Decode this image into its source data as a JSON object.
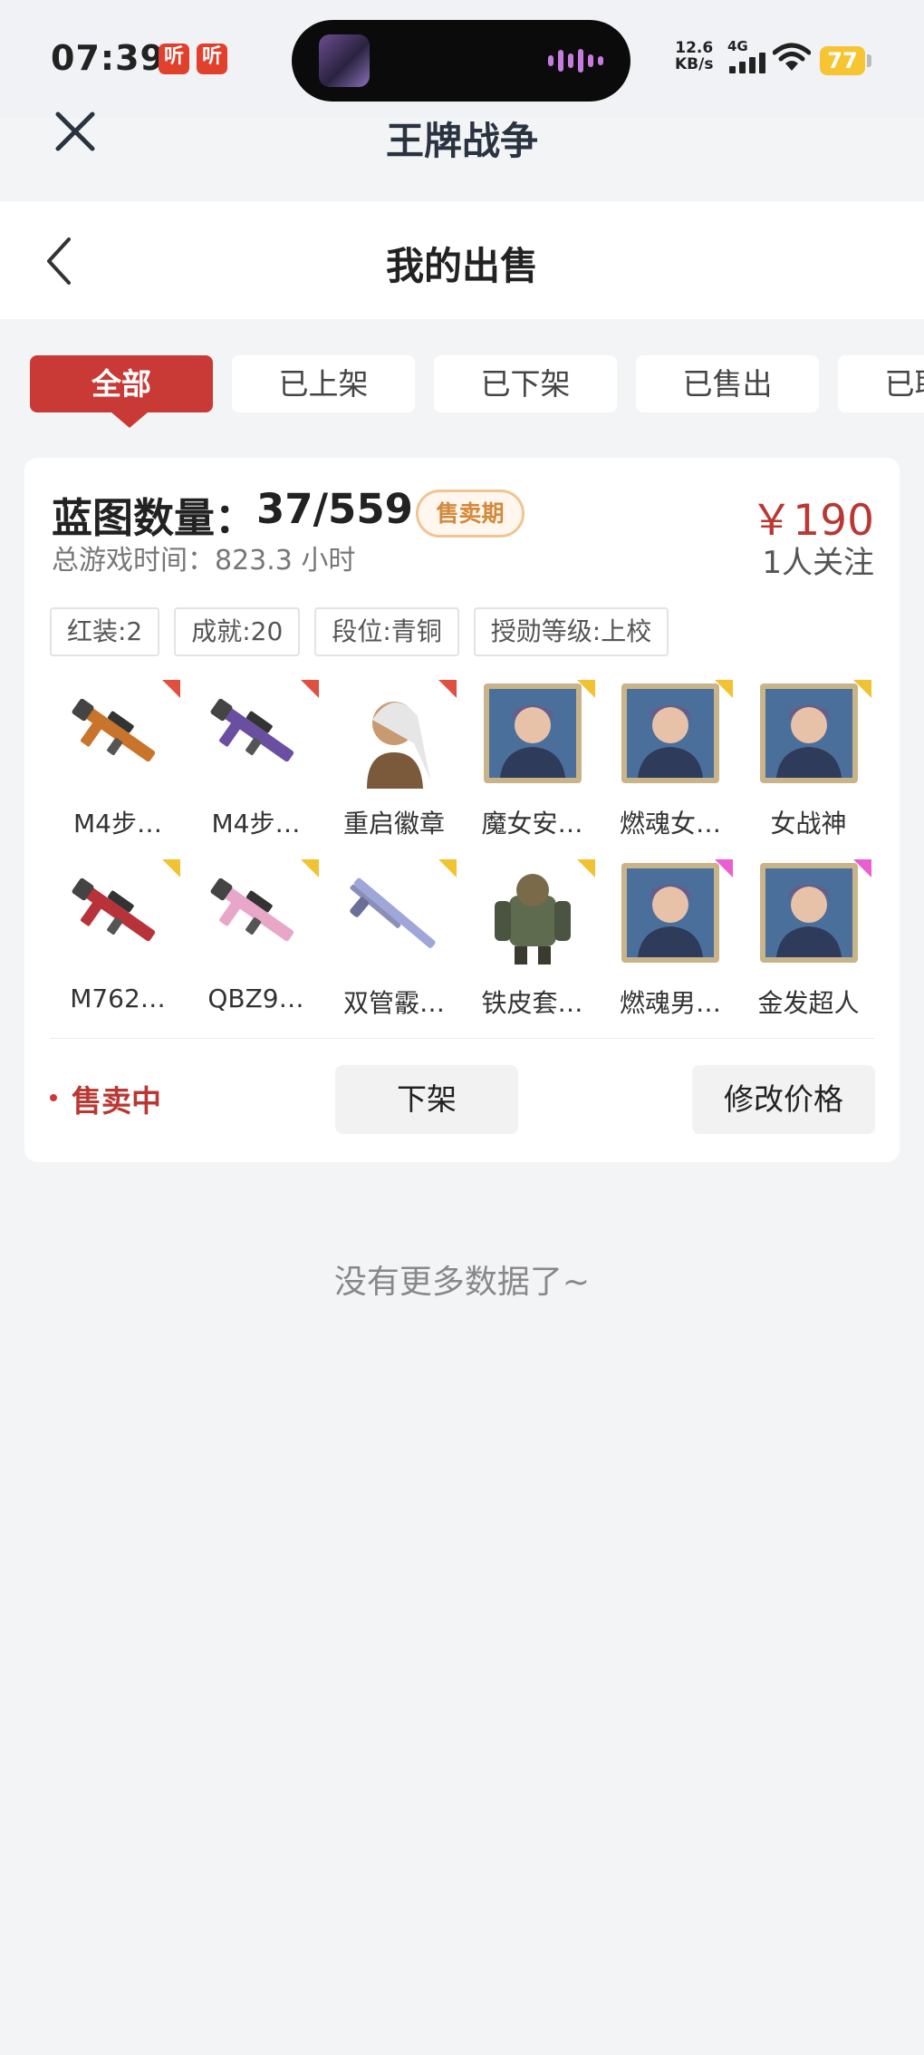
{
  "status_bar": {
    "time": "07:39",
    "app_badges": [
      "听",
      "听"
    ],
    "net_speed_value": "12.6",
    "net_speed_unit": "KB/s",
    "network": "4G",
    "battery": "77"
  },
  "app": {
    "title": "王牌战争"
  },
  "header": {
    "title": "我的出售"
  },
  "tabs": [
    {
      "label": "全部",
      "active": true
    },
    {
      "label": "已上架",
      "active": false
    },
    {
      "label": "已下架",
      "active": false
    },
    {
      "label": "已售出",
      "active": false
    },
    {
      "label": "已取消",
      "active": false
    }
  ],
  "listing": {
    "blueprint_label": "蓝图数量：",
    "blueprint_value": "37/559",
    "period_badge": "售卖期",
    "playtime": "总游戏时间：823.3 小时",
    "price": "￥190",
    "followers": "1人关注",
    "tags": [
      "红装:2",
      "成就:20",
      "段位:青铜",
      "授勋等级:上校"
    ],
    "items": [
      {
        "name": "M4步…",
        "kind": "rifle",
        "rarity": "red"
      },
      {
        "name": "M4步…",
        "kind": "rifle",
        "rarity": "red"
      },
      {
        "name": "重启徽章",
        "kind": "character",
        "rarity": "red"
      },
      {
        "name": "魔女安…",
        "kind": "portrait",
        "rarity": "yellow"
      },
      {
        "name": "燃魂女…",
        "kind": "portrait",
        "rarity": "yellow"
      },
      {
        "name": "女战神",
        "kind": "portrait",
        "rarity": "yellow"
      },
      {
        "name": "M762…",
        "kind": "rifle",
        "rarity": "yellow"
      },
      {
        "name": "QBZ9…",
        "kind": "rifle",
        "rarity": "yellow"
      },
      {
        "name": "双管霰…",
        "kind": "shotgun",
        "rarity": "yellow"
      },
      {
        "name": "铁皮套…",
        "kind": "armor",
        "rarity": "yellow"
      },
      {
        "name": "燃魂男…",
        "kind": "portrait",
        "rarity": "pink"
      },
      {
        "name": "金发超人",
        "kind": "portrait",
        "rarity": "pink"
      }
    ],
    "status": "售卖中",
    "btn_delist": "下架",
    "btn_edit_price": "修改价格"
  },
  "footer": {
    "no_more": "没有更多数据了~"
  },
  "colors": {
    "accent": "#c93a36",
    "price": "#b83834",
    "rarity_red": "#e0503e",
    "rarity_yellow": "#f1c232",
    "rarity_pink": "#e95fd2"
  },
  "icons": [
    "close-icon",
    "back-arrow-icon",
    "wifi-icon",
    "signal-icon",
    "battery-icon"
  ]
}
